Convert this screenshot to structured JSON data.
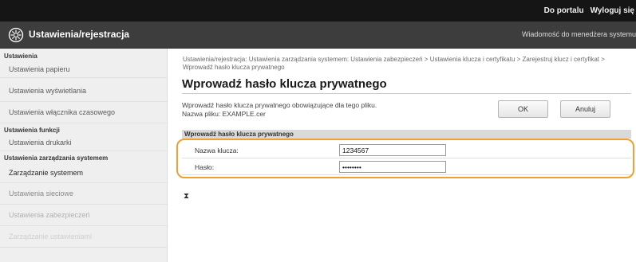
{
  "topbar": {
    "portal_link": "Do portalu",
    "logout_link": "Wyloguj się"
  },
  "header": {
    "app_title": "Ustawienia/rejestracja",
    "admin_message": "Wiadomość do menedżera systemu"
  },
  "sidebar": {
    "sections": [
      {
        "title": "Ustawienia",
        "items": [
          "Ustawienia papieru",
          "Ustawienia wyświetlania",
          "Ustawienia włącznika czasowego"
        ]
      },
      {
        "title": "Ustawienia funkcji",
        "items": [
          "Ustawienia drukarki"
        ]
      },
      {
        "title": "Ustawienia zarządzania systemem",
        "items": [
          "Zarządzanie systemem",
          "Ustawienia sieciowe",
          "Ustawienia zabezpieczeń",
          "Zarządzanie ustawieniami"
        ]
      }
    ]
  },
  "main": {
    "breadcrumb": "Ustawienia/rejestracja: Ustawienia zarządzania systemem: Ustawienia zabezpieczeń > Ustawienia klucza i certyfikatu > Zarejestruj klucz i certyfikat > Wprowadź hasło klucza prywatnego",
    "page_title": "Wprowadź hasło klucza prywatnego",
    "description_line1": "Wprowadź hasło klucza prywatnego obowiązujące dla tego pliku.",
    "description_line2": "Nazwa pliku: EXAMPLE.cer",
    "ok_label": "OK",
    "cancel_label": "Anuluj",
    "section_title": "Wprowadź hasło klucza prywatnego",
    "fields": [
      {
        "label": "Nazwa klucza:",
        "value": "1234567"
      },
      {
        "label": "Hasło:",
        "value": "••••••••"
      }
    ],
    "hourglass_glyph": "⧗"
  },
  "colors": {
    "topbar": "#151515",
    "titlebar": "#3d3d3d",
    "sidebar": "#efefef",
    "highlight": "#f0a030",
    "section_header": "#d9d9d9"
  }
}
